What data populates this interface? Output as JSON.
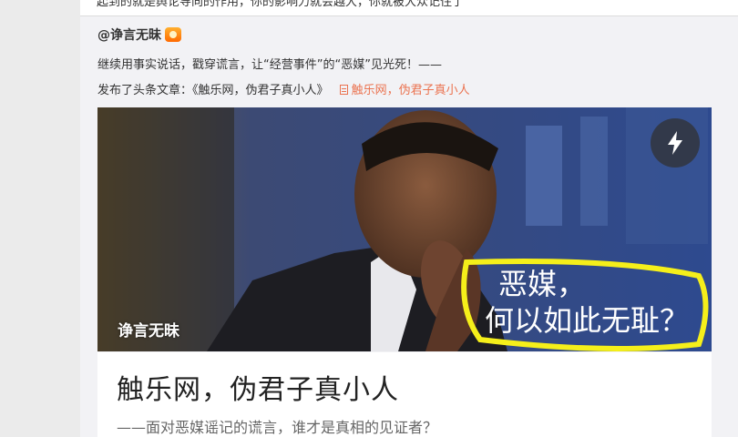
{
  "previous_post": {
    "text_fragment": "起到的就是舆论导向的作用，你的影响力就会越大，你就被大众记住了"
  },
  "post": {
    "author": "@诤言无昧",
    "text": "继续用事实说话，戳穿谎言，让“经营事件”的“恶媒”见光死！——",
    "share_prefix": "发布了头条文章：《触乐网，伪君子真小人》",
    "article_link_label": "触乐网，伪君子真小人"
  },
  "card": {
    "cover_author": "诤言无昧",
    "speech_line1": "恶媒，",
    "speech_line2": "何以如此无耻？",
    "title": "触乐网，伪君子真小人",
    "subtitle": "——面对恶媒谣记的谎言，谁才是真相的见证者？"
  },
  "icons": {
    "author_badge": "vip-badge-icon",
    "article_link": "document-icon",
    "flash_button": "lightning-icon"
  },
  "colors": {
    "link": "#eb7350",
    "highlight_outline": "#f5ef1a"
  }
}
